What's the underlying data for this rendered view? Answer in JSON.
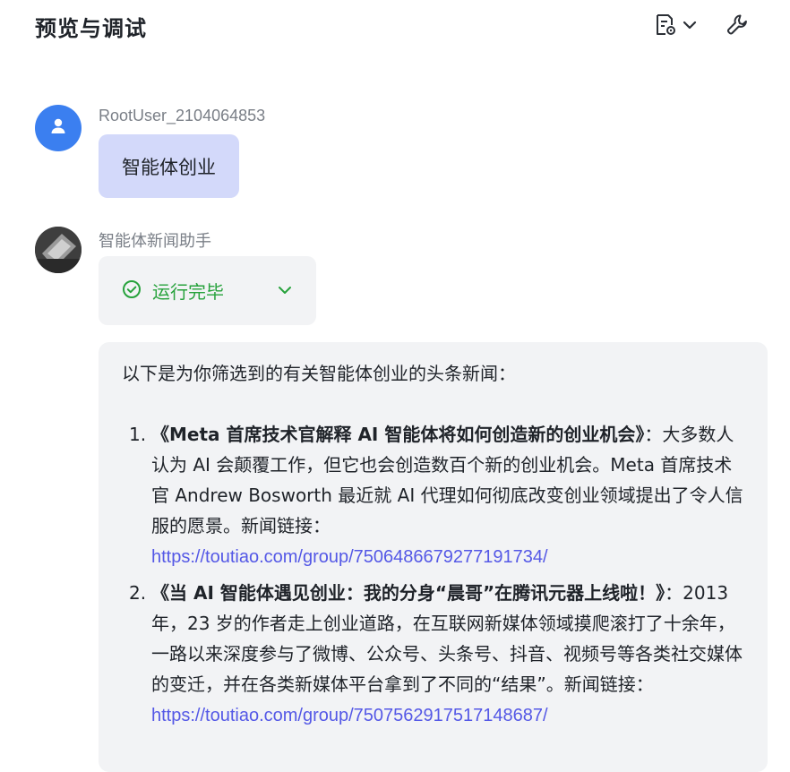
{
  "header": {
    "title": "预览与调试",
    "doc_icon": "document-settings-icon",
    "chevron_icon": "chevron-down-icon",
    "tool_icon": "wrench-icon"
  },
  "messages": {
    "user": {
      "name": "RootUser_2104064853",
      "text": "智能体创业",
      "avatar_icon": "person-icon"
    },
    "bot": {
      "name": "智能体新闻助手",
      "status": "运行完毕",
      "status_icon": "check-circle-icon",
      "intro": "以下是为你筛选到的有关智能体创业的头条新闻：",
      "items": [
        {
          "num": "1.",
          "title": "《Meta 首席技术官解释 AI 智能体将如何创造新的创业机会》",
          "body": "：大多数人认为 AI 会颠覆工作，但它也会创造数百个新的创业机会。Meta 首席技术官 Andrew Bosworth 最近就 AI 代理如何彻底改变创业领域提出了令人信服的愿景。新闻链接：",
          "link": "https://toutiao.com/group/7506486679277191734/"
        },
        {
          "num": "2.",
          "title": "《当 AI 智能体遇见创业：我的分身“晨哥”在腾讯元器上线啦！》",
          "body": "：2013 年，23 岁的作者走上创业道路，在互联网新媒体领域摸爬滚打了十余年，一路以来深度参与了微博、公众号、头条号、抖音、视频号等各类社交媒体的变迁，并在各类新媒体平台拿到了不同的“结果”。新闻链接：",
          "link": "https://toutiao.com/group/7507562917517148687/"
        }
      ]
    }
  },
  "colors": {
    "accent": "#5458e6",
    "user_bubble": "#d3d9fa",
    "status_green": "#27a23c",
    "panel_bg": "#f2f3f5",
    "user_avatar": "#3b7ff0"
  }
}
